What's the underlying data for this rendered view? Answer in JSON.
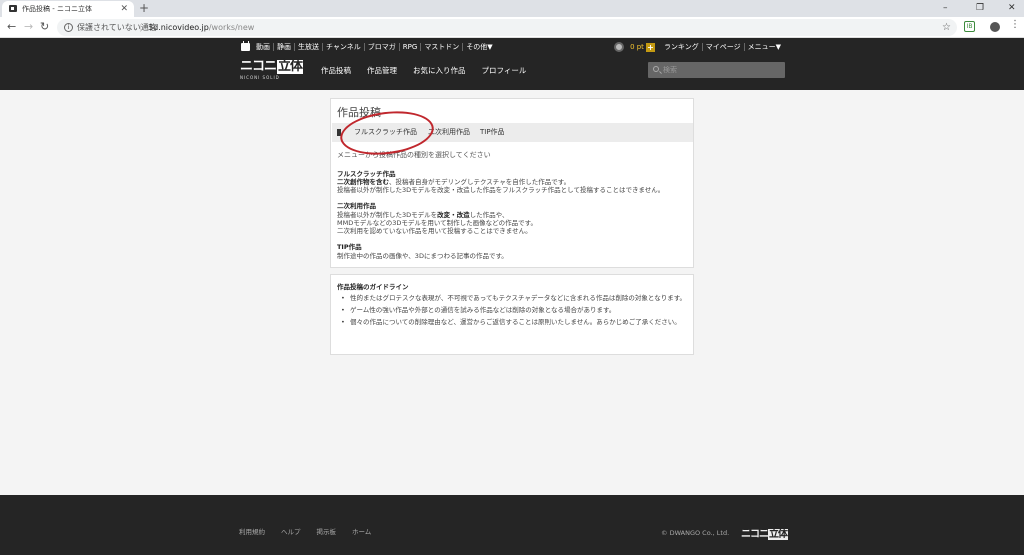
{
  "browser": {
    "tab_title": "作品投稿 - ニコニ立体",
    "new_tab": "+",
    "security_label": "保護されていない通信",
    "url_host": "3d.nicovideo.jp",
    "url_path": "/works/new",
    "win_minimize": "–",
    "win_restore": "❐",
    "win_close": "✕",
    "ext_label": "IB"
  },
  "header": {
    "top_nav": [
      "動画",
      "静画",
      "生放送",
      "チャンネル",
      "ブロマガ",
      "RPG",
      "マストドン",
      "その他▼"
    ],
    "points": "0 pt",
    "points_plus": "+",
    "top_right": [
      "ランキング",
      "マイページ",
      "メニュー▼"
    ],
    "logo_text": "ニコニ",
    "logo_box": "立体",
    "logo_sub": "NICONI SOLID",
    "main_nav": [
      "作品投稿",
      "作品管理",
      "お気に入り作品",
      "プロフィール"
    ],
    "search_placeholder": "検索"
  },
  "main": {
    "title": "作品投稿",
    "tabs": [
      "フルスクラッチ作品",
      "二次利用作品",
      "TIP作品"
    ],
    "intro": "メニューから投稿作品の種別を選択してください",
    "sections": [
      {
        "heading": "フルスクラッチ作品",
        "lines": [
          {
            "bold": "二次創作物を含む",
            "text": "、投稿者自身がモデリングしテクスチャを自作した作品です。"
          },
          {
            "bold": "",
            "text": "投稿者以外が制作した3Dモデルを改変・改造した作品をフルスクラッチ作品として投稿することはできません。"
          }
        ]
      },
      {
        "heading": "二次利用作品",
        "lines": [
          {
            "bold": "",
            "text": "投稿者以外が制作した3Dモデルを",
            "bold2": "改変・改造",
            "text2": "した作品や、"
          },
          {
            "bold": "",
            "text": "MMDモデルなどの3Dモデルを用いて制作した画像などの作品です。"
          },
          {
            "bold": "",
            "text": "二次利用を認めていない作品を用いて投稿することはできません。"
          }
        ]
      },
      {
        "heading": "TIP作品",
        "lines": [
          {
            "bold": "",
            "text": "制作途中の作品の画像や、3Dにまつわる記事の作品です。"
          }
        ]
      }
    ]
  },
  "guidelines": {
    "title": "作品投稿のガイドライン",
    "items": [
      "性的またはグロテスクな表現が、不可視であってもテクスチャデータなどに含まれる作品は削除の対象となります。",
      "ゲーム性の強い作品や外部との通信を試みる作品などは削除の対象となる場合があります。",
      "個々の作品についての削除理由など、運営からご返信することは原則いたしません。あらかじめご了承ください。"
    ]
  },
  "footer": {
    "links": [
      "利用規約",
      "ヘルプ",
      "掲示板",
      "ホーム"
    ],
    "copyright": "© DWANGO Co., Ltd.",
    "logo_text": "ニコニ",
    "logo_box": "立体"
  },
  "colors": {
    "header_bg": "#252525",
    "annotation_circle": "#c0272d",
    "points": "#f4c430"
  }
}
